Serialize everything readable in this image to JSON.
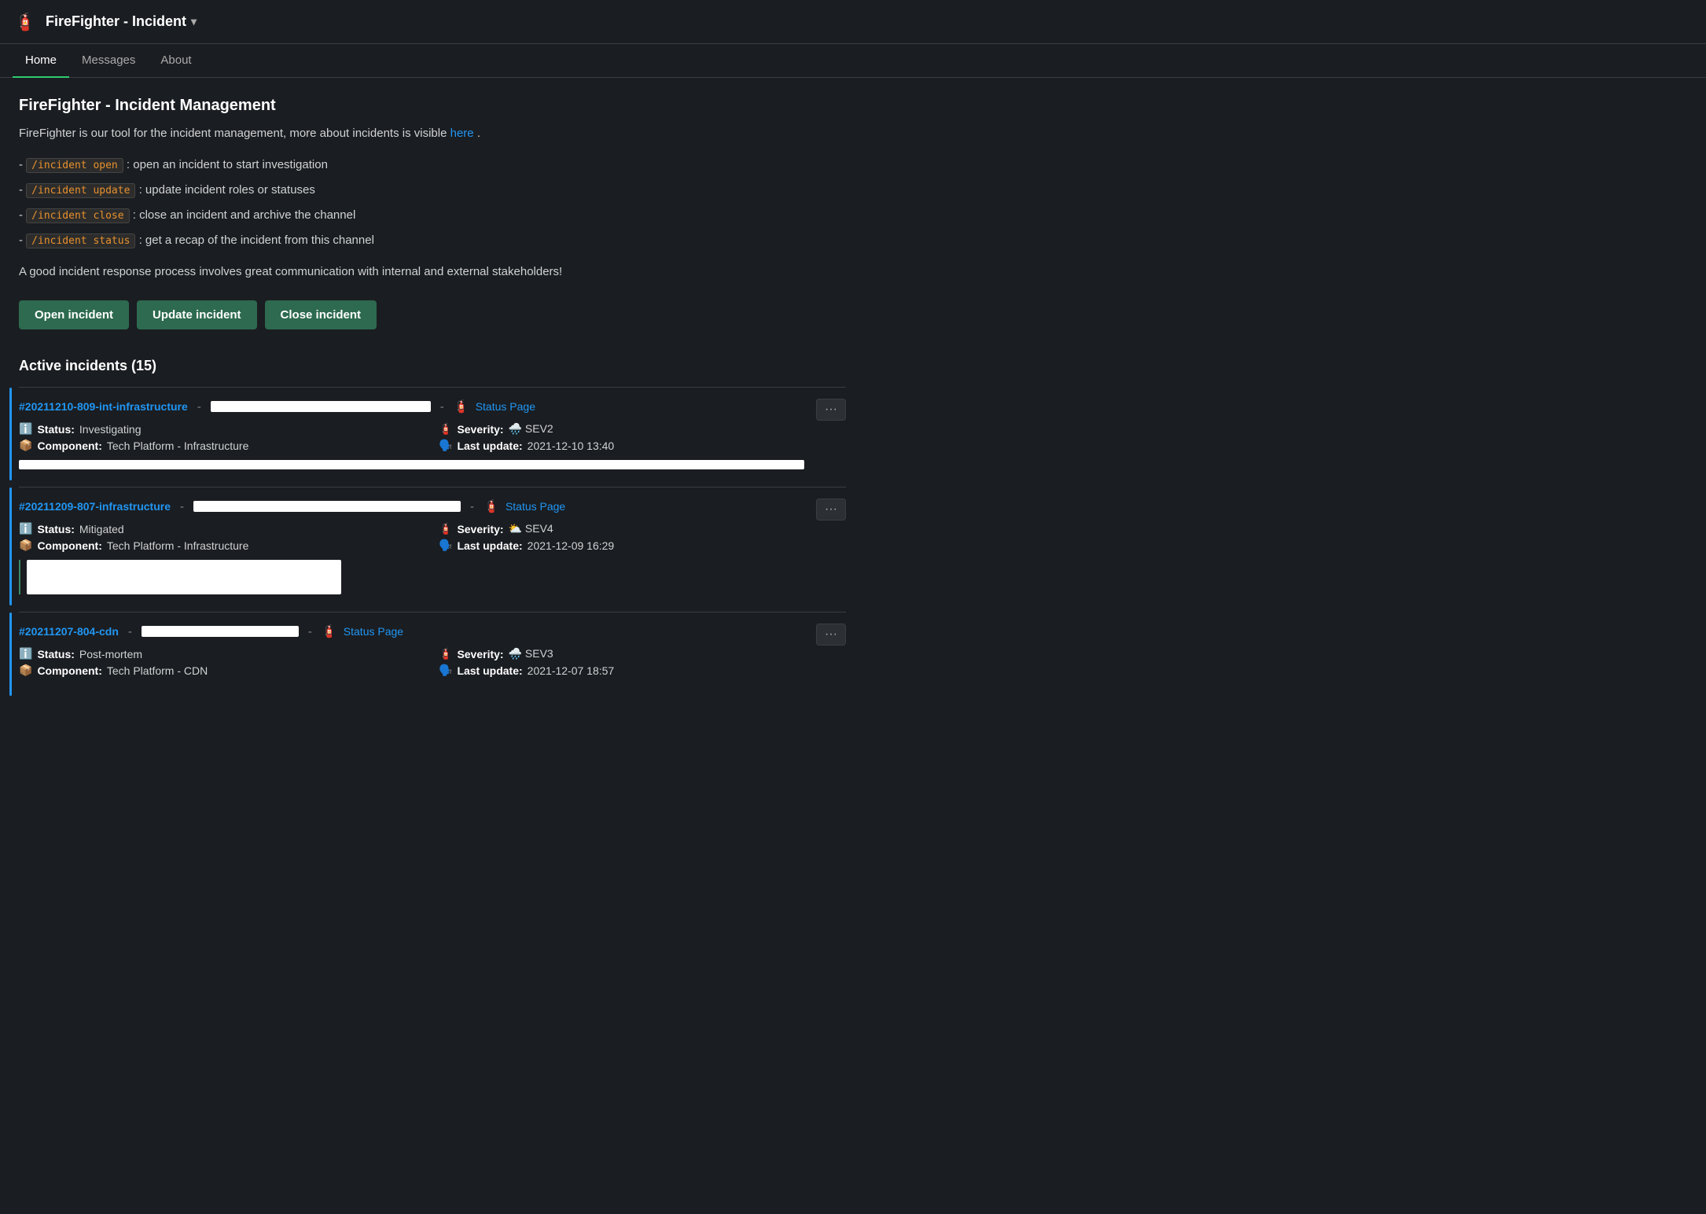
{
  "app": {
    "icon": "🧯",
    "title": "FireFighter - Incident",
    "chevron": "▾"
  },
  "nav": {
    "tabs": [
      {
        "label": "Home",
        "active": true
      },
      {
        "label": "Messages",
        "active": false
      },
      {
        "label": "About",
        "active": false
      }
    ]
  },
  "home": {
    "page_title": "FireFighter - Incident Management",
    "intro_text_before": "FireFighter is our tool for the incident management, more about incidents is visible",
    "intro_link_text": "here",
    "intro_text_after": ".",
    "commands": [
      {
        "code": "/incident open",
        "description": ": open an incident to start investigation"
      },
      {
        "code": "/incident update",
        "description": ": update incident roles or statuses"
      },
      {
        "code": "/incident close",
        "description": ": close an incident and archive the channel"
      },
      {
        "code": "/incident status",
        "description": ": get a recap of the incident from this channel"
      }
    ],
    "tagline": "A good incident response process involves great communication with internal and external stakeholders!",
    "buttons": [
      {
        "label": "Open incident",
        "key": "open"
      },
      {
        "label": "Update incident",
        "key": "update"
      },
      {
        "label": "Close incident",
        "key": "close"
      }
    ],
    "active_incidents_title": "Active incidents (15)",
    "incidents": [
      {
        "id": "#20211210-809-int-infrastructure",
        "status_page_label": "Status Page",
        "status_icon": "ℹ️",
        "status_label": "Status:",
        "status_value": "Investigating",
        "component_icon": "📦",
        "component_label": "Component:",
        "component_value": "Tech Platform - Infrastructure",
        "severity_icon": "🧯",
        "severity_label": "Severity:",
        "severity_value": "🌧️ SEV2",
        "update_icon": "🗣️",
        "update_label": "Last update:",
        "update_value": "2021-12-10 13:40",
        "has_long_bar": true,
        "has_short_bar": false
      },
      {
        "id": "#20211209-807-infrastructure",
        "status_page_label": "Status Page",
        "status_icon": "ℹ️",
        "status_label": "Status:",
        "status_value": "Mitigated",
        "component_icon": "📦",
        "component_label": "Component:",
        "component_value": "Tech Platform - Infrastructure",
        "severity_icon": "🧯",
        "severity_label": "Severity:",
        "severity_value": "⛅ SEV4",
        "update_icon": "🗣️",
        "update_label": "Last update:",
        "update_value": "2021-12-09 16:29",
        "has_long_bar": false,
        "has_short_bar": true
      },
      {
        "id": "#20211207-804-cdn",
        "status_page_label": "Status Page",
        "status_icon": "ℹ️",
        "status_label": "Status:",
        "status_value": "Post-mortem",
        "component_icon": "📦",
        "component_label": "Component:",
        "component_value": "Tech Platform - CDN",
        "severity_icon": "🧯",
        "severity_label": "Severity:",
        "severity_value": "🌧️ SEV3",
        "update_icon": "🗣️",
        "update_label": "Last update:",
        "update_value": "2021-12-07 18:57",
        "has_long_bar": false,
        "has_short_bar": false
      }
    ]
  },
  "icons": {
    "fire_extinguisher": "🧯",
    "info": "ℹ️",
    "box": "📦",
    "chat": "🗣️",
    "more": "···"
  }
}
